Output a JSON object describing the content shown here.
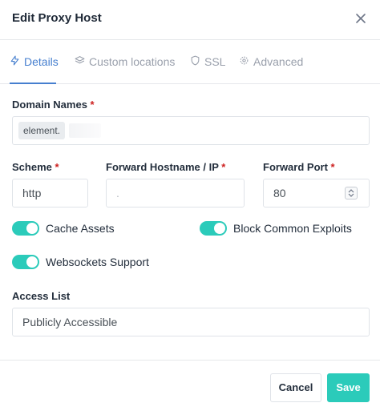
{
  "modal": {
    "title": "Edit Proxy Host"
  },
  "tabs": [
    {
      "label": "Details",
      "icon": "bolt-icon",
      "active": true
    },
    {
      "label": "Custom locations",
      "icon": "layers-icon",
      "active": false
    },
    {
      "label": "SSL",
      "icon": "shield-icon",
      "active": false
    },
    {
      "label": "Advanced",
      "icon": "gear-icon",
      "active": false
    }
  ],
  "form": {
    "domain_names": {
      "label": "Domain Names",
      "required_mark": "*",
      "chip": "element."
    },
    "scheme": {
      "label": "Scheme",
      "required_mark": "*",
      "value": "http"
    },
    "forward_hostname": {
      "label": "Forward Hostname / IP",
      "required_mark": "*",
      "value": "."
    },
    "forward_port": {
      "label": "Forward Port",
      "required_mark": "*",
      "value": "80"
    },
    "toggles": {
      "cache_assets": {
        "label": "Cache Assets",
        "on": true
      },
      "block_exploits": {
        "label": "Block Common Exploits",
        "on": true
      },
      "websockets": {
        "label": "Websockets Support",
        "on": true
      }
    },
    "access_list": {
      "label": "Access List",
      "value": "Publicly Accessible"
    }
  },
  "footer": {
    "cancel_label": "Cancel",
    "save_label": "Save"
  },
  "colors": {
    "accent": "#467fcf",
    "toggle_on": "#2bcbba",
    "save_button": "#2bcbba",
    "required": "#cd201f"
  }
}
